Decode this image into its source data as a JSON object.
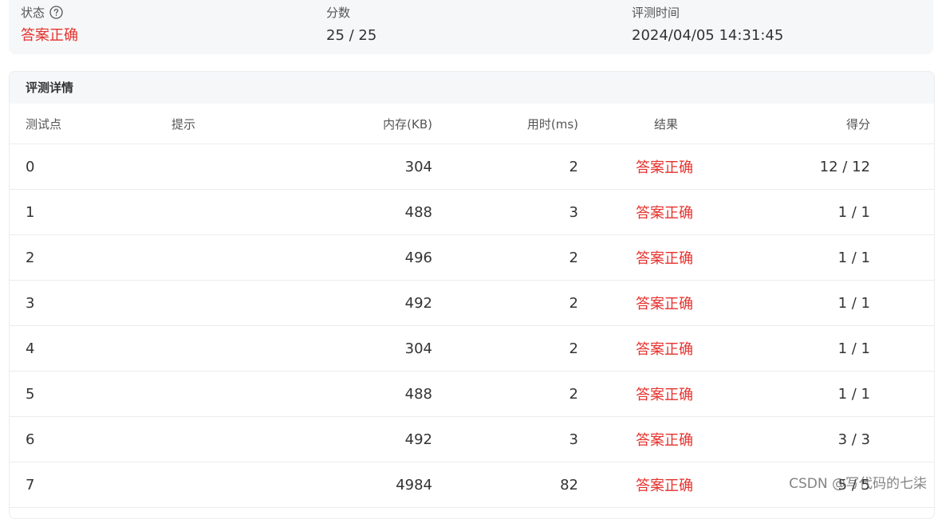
{
  "summary": {
    "status": {
      "label": "状态",
      "value": "答案正确"
    },
    "score": {
      "label": "分数",
      "value": "25 / 25"
    },
    "judge_time": {
      "label": "评测时间",
      "value": "2024/04/05 14:31:45"
    }
  },
  "details": {
    "title": "评测详情",
    "columns": {
      "test_point": "测试点",
      "hint": "提示",
      "memory": "内存(KB)",
      "time": "用时(ms)",
      "result": "结果",
      "score": "得分"
    },
    "rows": [
      {
        "id": "0",
        "hint": "",
        "memory": "304",
        "time": "2",
        "result": "答案正确",
        "score": "12 / 12"
      },
      {
        "id": "1",
        "hint": "",
        "memory": "488",
        "time": "3",
        "result": "答案正确",
        "score": "1 / 1"
      },
      {
        "id": "2",
        "hint": "",
        "memory": "496",
        "time": "2",
        "result": "答案正确",
        "score": "1 / 1"
      },
      {
        "id": "3",
        "hint": "",
        "memory": "492",
        "time": "2",
        "result": "答案正确",
        "score": "1 / 1"
      },
      {
        "id": "4",
        "hint": "",
        "memory": "304",
        "time": "2",
        "result": "答案正确",
        "score": "1 / 1"
      },
      {
        "id": "5",
        "hint": "",
        "memory": "488",
        "time": "2",
        "result": "答案正确",
        "score": "1 / 1"
      },
      {
        "id": "6",
        "hint": "",
        "memory": "492",
        "time": "3",
        "result": "答案正确",
        "score": "3 / 3"
      },
      {
        "id": "7",
        "hint": "",
        "memory": "4984",
        "time": "82",
        "result": "答案正确",
        "score": "5 / 5"
      }
    ]
  },
  "watermark": "CSDN @写代码的七柒",
  "colors": {
    "accepted": "#e5322d",
    "card_bg": "#f6f7f9",
    "border": "#ececec"
  },
  "icons": {
    "status_help": "question-circle-icon"
  }
}
